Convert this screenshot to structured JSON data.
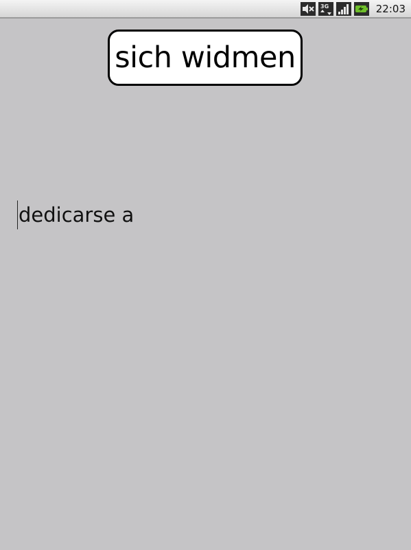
{
  "status_bar": {
    "time": "22:03",
    "icons": [
      "volume-muted-icon",
      "3g-data-icon",
      "signal-strength-icon",
      "battery-charging-icon"
    ],
    "battery_color": "#6fbf2a"
  },
  "card": {
    "word": "sich widmen"
  },
  "answer": {
    "text": "dedicarse a"
  },
  "colors": {
    "background": "#c5c4c6",
    "card_background": "#ffffff",
    "card_border": "#000000"
  }
}
